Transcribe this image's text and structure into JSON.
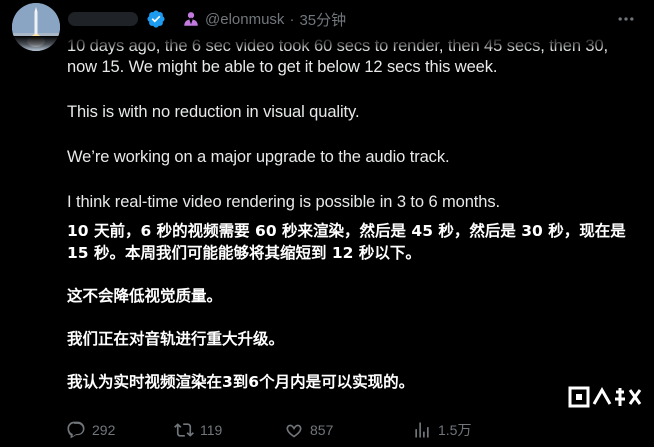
{
  "header": {
    "handle": "@elonmusk",
    "separator": "·",
    "timestamp": "35分钟"
  },
  "tweet": {
    "english": [
      "10 days ago, the 6 sec video took 60 secs to render, then 45 secs, then 30, now 15. We might be able to get it below 12 secs this week.",
      "This is with no reduction in visual quality.",
      "We’re working on a major upgrade to the audio track.",
      "I think real-time video rendering is possible in 3 to 6 months."
    ],
    "translation": [
      "10 天前，6 秒的视频需要 60 秒来渲染，然后是 45 秒，然后是 30 秒，现在是 15 秒。本周我们可能能够将其缩短到 12 秒以下。",
      "这不会降低视觉质量。",
      "我们正在对音轨进行重大升级。",
      "我认为实时视频渲染在3到6个月内是可以实现的。"
    ]
  },
  "actions": {
    "replies": "292",
    "retweets": "119",
    "likes": "857",
    "views": "1.5万"
  },
  "colors": {
    "background": "#000000",
    "text": "#e7e9ea",
    "muted": "#71767b",
    "verified": "#1d9bf0",
    "affiliate": "#c27ae0"
  }
}
